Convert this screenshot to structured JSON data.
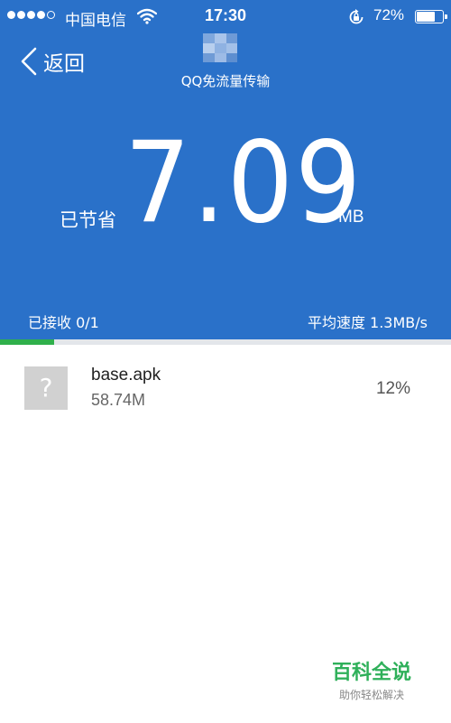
{
  "status_bar": {
    "carrier": "中国电信",
    "time": "17:30",
    "battery_percent": "72%",
    "battery_level": 0.72,
    "signal_bars_filled": 4,
    "signal_bars_total": 5
  },
  "nav": {
    "back_label": "返回",
    "title": "QQ免流量传输"
  },
  "savings": {
    "label": "已节省",
    "value": "7.09",
    "unit": "MB"
  },
  "transfer": {
    "received": "已接收 0/1",
    "speed": "平均速度 1.3MB/s",
    "progress": 0.12
  },
  "files": [
    {
      "icon": "unknown-file-icon",
      "name": "base.apk",
      "size": "58.74M",
      "percent": "12%"
    }
  ],
  "watermark": {
    "title": "百科全说",
    "subtitle": "助你轻松解决"
  },
  "colors": {
    "header_bg": "#2a71c9",
    "progress": "#2fb04b",
    "watermark": "#2fb05a"
  }
}
